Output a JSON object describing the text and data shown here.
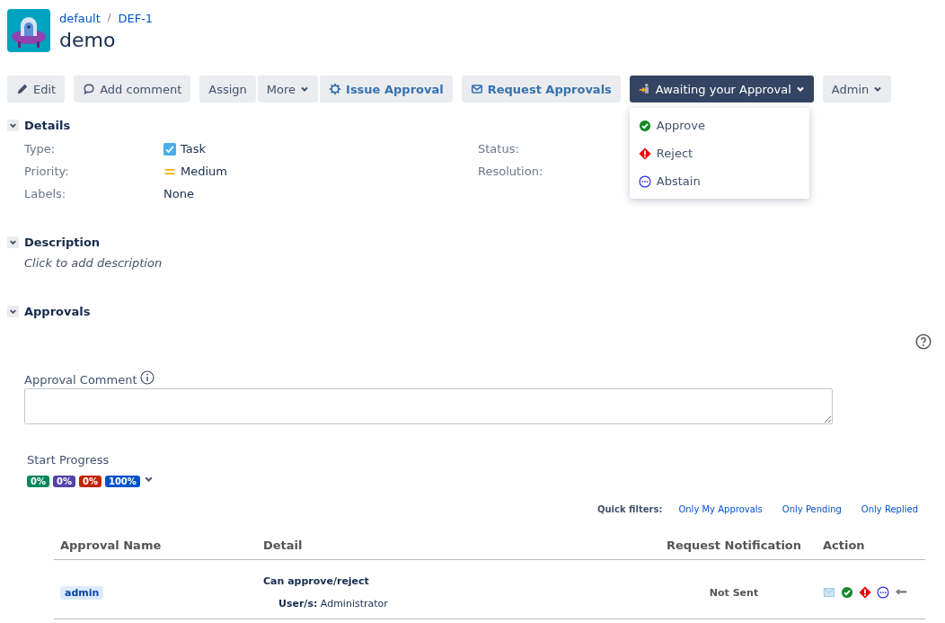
{
  "breadcrumb": [
    "default",
    "DEF-1"
  ],
  "breadcrumb_separator": "/",
  "title": "demo",
  "toolbar": [
    [
      {
        "label": "Edit",
        "kind": "edit"
      }
    ],
    [
      {
        "label": "Add comment",
        "kind": "comment"
      }
    ],
    [
      {
        "label": "Assign",
        "kind": "plain"
      },
      {
        "label": "More",
        "kind": "menu"
      },
      {
        "label": "Issue Approval",
        "kind": "issue"
      }
    ],
    [
      {
        "label": "Request Approvals",
        "kind": "request"
      }
    ],
    [
      {
        "label": "Awaiting your Approval",
        "kind": "awaiting"
      }
    ],
    [
      {
        "label": "Admin",
        "kind": "menu"
      }
    ]
  ],
  "dropdown": {
    "open": true,
    "items": [
      {
        "label": "Approve",
        "kind": "approve"
      },
      {
        "label": "Reject",
        "kind": "reject"
      },
      {
        "label": "Abstain",
        "kind": "abstain"
      }
    ]
  },
  "details": {
    "title": "Details",
    "expanded": true,
    "left": [
      {
        "label": "Type:",
        "value": "Task",
        "kind": "task"
      },
      {
        "label": "Priority:",
        "value": "Medium",
        "kind": "priority"
      },
      {
        "label": "Labels:",
        "value": "None",
        "kind": "plain"
      }
    ],
    "right": [
      {
        "label": "Status:"
      },
      {
        "label": "Resolution:"
      }
    ]
  },
  "description": {
    "title": "Description",
    "expanded": true,
    "placeholder": "Click to add description"
  },
  "approvals": {
    "title": "Approvals",
    "expanded": true,
    "comment_label": "Approval Comment",
    "progress_label": "Start Progress",
    "progress": [
      {
        "label": "0%",
        "color": "#00875a"
      },
      {
        "label": "0%",
        "color": "#5243aa"
      },
      {
        "label": "0%",
        "color": "#bf2600"
      },
      {
        "label": "100%",
        "color": "#0052cc"
      }
    ],
    "quick_filters_label": "Quick filters:",
    "quick_filters": [
      "Only My Approvals",
      "Only Pending",
      "Only Replied"
    ],
    "columns": [
      "Approval Name",
      "Detail",
      "Request Notification",
      "Action"
    ],
    "rows": [
      {
        "name": "admin",
        "detail_title": "Can approve/reject",
        "detail_users": "**User/s:** Administrator",
        "notification": "Not Sent",
        "actions": [
          {
            "kind": "mail"
          },
          {
            "kind": "approve"
          },
          {
            "kind": "reject"
          },
          {
            "kind": "abstain"
          },
          {
            "kind": "back"
          }
        ]
      }
    ]
  }
}
